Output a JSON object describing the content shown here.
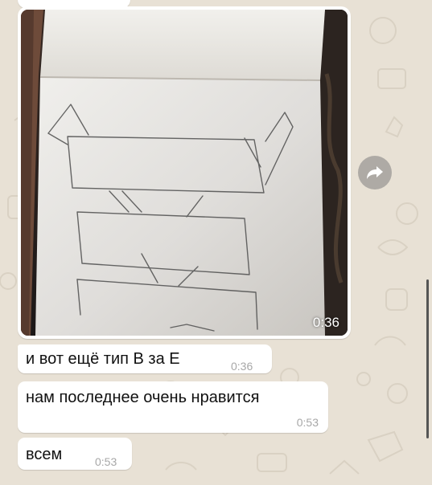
{
  "chat": {
    "image_message": {
      "time": "0:36"
    },
    "messages": [
      {
        "text": "и вот ещё тип В за Е",
        "time": "0:36"
      },
      {
        "text": "нам последнее очень нравится",
        "time": "0:53"
      },
      {
        "text": "всем",
        "time": "0:53"
      }
    ]
  },
  "icons": {
    "forward": "forward-arrow-icon",
    "wallpaper": "doodle-wallpaper"
  },
  "colors": {
    "wallpaper": "#e9e2d6",
    "bubble": "#ffffff",
    "timestamp": "#a7a7a7",
    "forward_button": "#7d7d7d"
  }
}
